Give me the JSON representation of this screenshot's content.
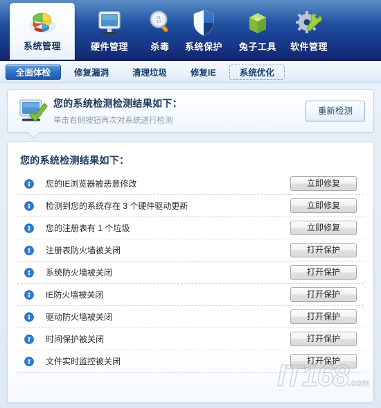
{
  "nav": {
    "items": [
      {
        "label": "系统管理",
        "icon": "pie-chart-icon",
        "active": true
      },
      {
        "label": "硬件管理",
        "icon": "monitor-icon",
        "active": false
      },
      {
        "label": "杀毒",
        "icon": "magnifier-icon",
        "active": false
      },
      {
        "label": "系统保护",
        "icon": "shield-icon",
        "active": false
      },
      {
        "label": "兔子工具",
        "icon": "green-box-icon",
        "active": false
      },
      {
        "label": "软件管理",
        "icon": "gear-wrench-icon",
        "active": false
      }
    ]
  },
  "tabs": [
    {
      "label": "全面体检",
      "state": "active"
    },
    {
      "label": "修复漏洞",
      "state": "normal"
    },
    {
      "label": "清理垃圾",
      "state": "normal"
    },
    {
      "label": "修复IE",
      "state": "normal"
    },
    {
      "label": "系统优化",
      "state": "dashed"
    }
  ],
  "summary": {
    "icon": "monitor-check-icon",
    "title": "您的系统检测检测结果如下：",
    "subtitle": "单击右侧按钮再次对系统进行检测",
    "rescan_label": "重新检测"
  },
  "results": {
    "heading": "您的系统检测结果如下：",
    "rows": [
      {
        "icon": "info-exclamation-icon",
        "label": "您的IE浏览器被恶意修改",
        "action": "立即修复"
      },
      {
        "icon": "info-exclamation-icon",
        "label": "检测到您的系统存在 3 个硬件驱动更新",
        "action": "立即修复"
      },
      {
        "icon": "info-exclamation-icon",
        "label": "您的注册表有 1 个垃圾",
        "action": "立即修复"
      },
      {
        "icon": "info-exclamation-icon",
        "label": "注册表防火墙被关闭",
        "action": "打开保护"
      },
      {
        "icon": "info-exclamation-icon",
        "label": "系统防火墙被关闭",
        "action": "打开保护"
      },
      {
        "icon": "info-exclamation-icon",
        "label": "IE防火墙被关闭",
        "action": "打开保护"
      },
      {
        "icon": "info-exclamation-icon",
        "label": "驱动防火墙被关闭",
        "action": "打开保护"
      },
      {
        "icon": "info-exclamation-icon",
        "label": "时间保护被关闭",
        "action": "打开保护"
      },
      {
        "icon": "info-exclamation-icon",
        "label": "文件实时监控被关闭",
        "action": "打开保护"
      }
    ]
  },
  "watermark": {
    "text": "IT168",
    "suffix": ".com"
  },
  "colors": {
    "nav_top": "#3a77bc",
    "nav_bottom": "#102666",
    "tab_active": "#2f73c4",
    "info_blue": "#2b7fd4",
    "heading": "#1d3a5c",
    "subtitle": "#8a9bab"
  }
}
